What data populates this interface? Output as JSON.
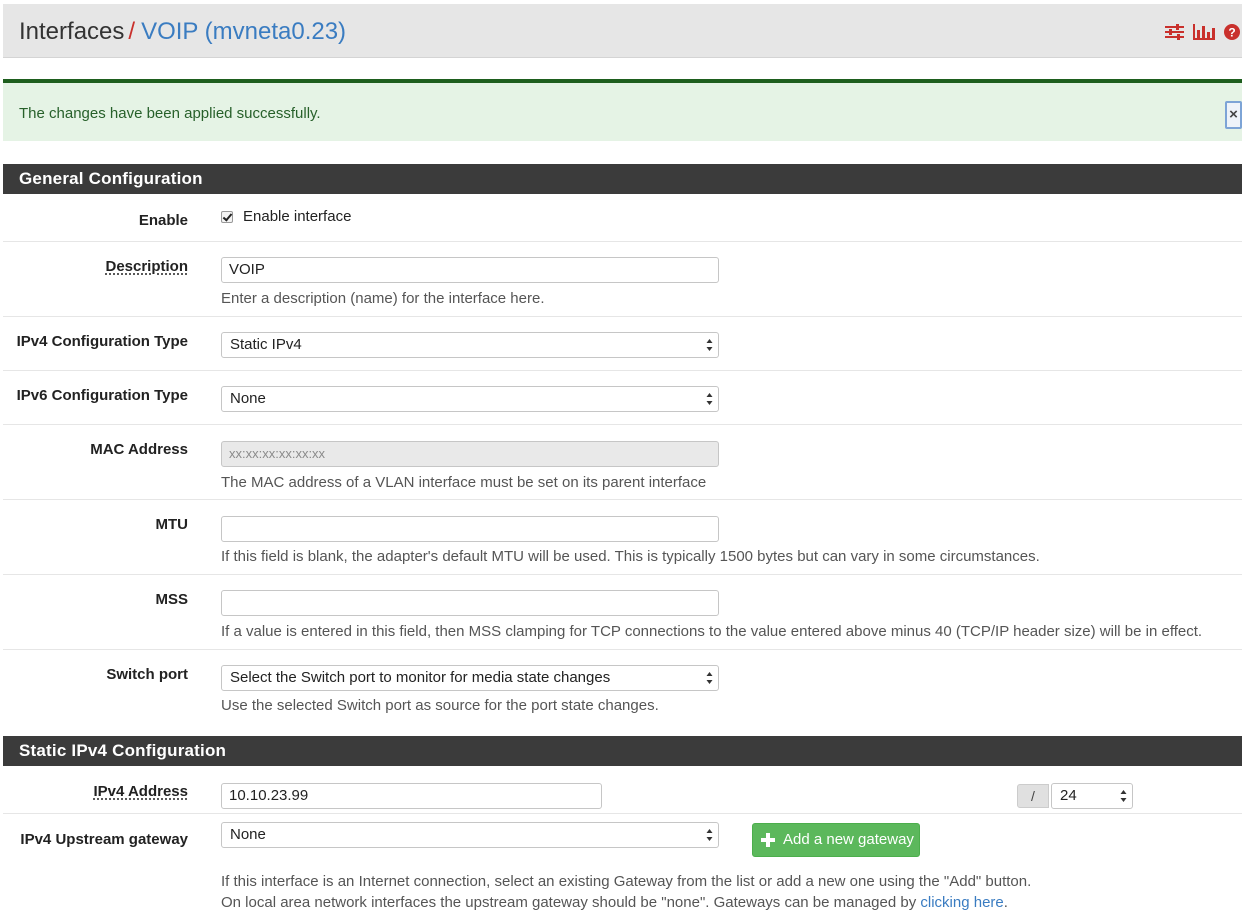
{
  "header": {
    "crumb_root": "Interfaces",
    "separator": "/",
    "crumb_current": "VOIP (mvneta0.23)",
    "icons": [
      "sliders-icon",
      "bar-chart-icon",
      "help-icon"
    ]
  },
  "alert": {
    "message": "The changes have been applied successfully.",
    "close_label": "×"
  },
  "general": {
    "title": "General Configuration",
    "enable": {
      "label": "Enable",
      "checkbox_label": "Enable interface",
      "checked": true
    },
    "description": {
      "label": "Description",
      "value": "VOIP",
      "help": "Enter a description (name) for the interface here."
    },
    "ipv4_type": {
      "label": "IPv4 Configuration Type",
      "value": "Static IPv4"
    },
    "ipv6_type": {
      "label": "IPv6 Configuration Type",
      "value": "None"
    },
    "mac": {
      "label": "MAC Address",
      "placeholder": "xx:xx:xx:xx:xx:xx",
      "help": "The MAC address of a VLAN interface must be set on its parent interface"
    },
    "mtu": {
      "label": "MTU",
      "value": "",
      "help": "If this field is blank, the adapter's default MTU will be used. This is typically 1500 bytes but can vary in some circumstances."
    },
    "mss": {
      "label": "MSS",
      "value": "",
      "help": "If a value is entered in this field, then MSS clamping for TCP connections to the value entered above minus 40 (TCP/IP header size) will be in effect."
    },
    "switch_port": {
      "label": "Switch port",
      "value": "Select the Switch port to monitor for media state changes",
      "help": "Use the selected Switch port as source for the port state changes."
    }
  },
  "static_ipv4": {
    "title": "Static IPv4 Configuration",
    "address": {
      "label": "IPv4 Address",
      "value": "10.10.23.99",
      "slash": "/",
      "cidr": "24"
    },
    "gateway": {
      "label": "IPv4 Upstream gateway",
      "value": "None",
      "add_button": "Add a new gateway",
      "help_line1": "If this interface is an Internet connection, select an existing Gateway from the list or add a new one using the \"Add\" button.",
      "help_line2": "On local area network interfaces the upstream gateway should be \"none\". Gateways can be managed by ",
      "help_link": "clicking here",
      "help_end": "."
    }
  },
  "colors": {
    "header_bg": "#e6e6e6",
    "crumb_link": "#3a7cc1",
    "separator": "#c9302c",
    "panel_head_bg": "#3b3b3b",
    "alert_bg": "#e5f3e5",
    "alert_text": "#27602a",
    "success_button": "#5cb85c"
  }
}
